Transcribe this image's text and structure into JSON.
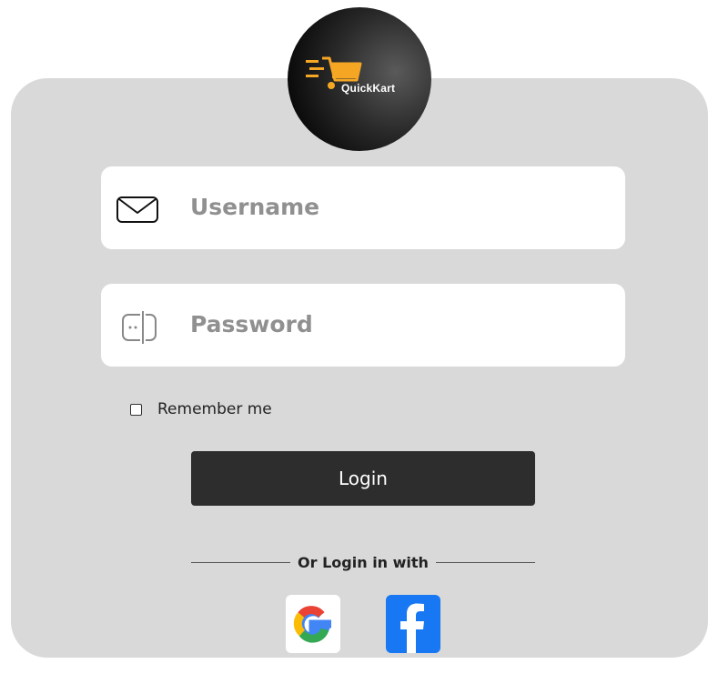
{
  "logo": {
    "text": "QuickKart"
  },
  "form": {
    "username_placeholder": "Username",
    "password_placeholder": "Password",
    "remember_label": "Remember me",
    "login_label": "Login",
    "divider_text": "Or Login in with"
  },
  "social": [
    {
      "name": "google",
      "icon": "google-icon"
    },
    {
      "name": "facebook",
      "icon": "facebook-icon"
    }
  ],
  "colors": {
    "card_bg": "#d9d9d9",
    "button_bg": "#2d2d2d",
    "accent": "#f5a623",
    "facebook_blue": "#1877f2"
  }
}
